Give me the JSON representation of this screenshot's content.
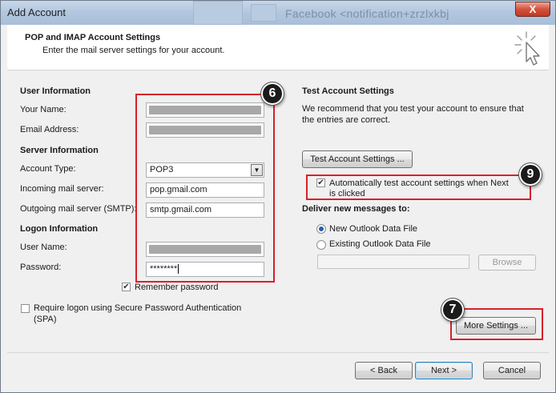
{
  "window": {
    "title": "Add Account",
    "background_title": "Facebook <notification+zrzlxkbj",
    "close_label": "X"
  },
  "header": {
    "title": "POP and IMAP Account Settings",
    "subtitle": "Enter the mail server settings for your account."
  },
  "left": {
    "user_info_heading": "User Information",
    "your_name_label": "Your Name:",
    "email_label": "Email Address:",
    "server_info_heading": "Server Information",
    "account_type_label": "Account Type:",
    "account_type_value": "POP3",
    "incoming_label": "Incoming mail server:",
    "incoming_value": "pop.gmail.com",
    "outgoing_label": "Outgoing mail server (SMTP):",
    "outgoing_value": "smtp.gmail.com",
    "logon_heading": "Logon Information",
    "username_label": "User Name:",
    "password_label": "Password:",
    "password_value": "********",
    "remember_label": "Remember password",
    "spa_label_line1": "Require logon using Secure Password Authentication",
    "spa_label_line2": "(SPA)"
  },
  "right": {
    "test_heading": "Test Account Settings",
    "test_desc_line1": "We recommend that you test your account to ensure that",
    "test_desc_line2": "the entries are correct.",
    "test_button": "Test Account Settings ...",
    "auto_test_line1": "Automatically test account settings when Next",
    "auto_test_line2": "is clicked",
    "deliver_heading": "Deliver new messages to:",
    "new_file_label": "New Outlook Data File",
    "existing_file_label": "Existing Outlook Data File",
    "browse_button": "Browse",
    "more_settings_button": "More Settings ..."
  },
  "footer": {
    "back_button": "< Back",
    "next_button": "Next >",
    "cancel_button": "Cancel"
  },
  "annotations": {
    "badge_6": "6",
    "badge_7": "7",
    "badge_9": "9"
  },
  "colors": {
    "annotation_red": "#d9202a",
    "titlebar_blue": "#b3c7df"
  }
}
